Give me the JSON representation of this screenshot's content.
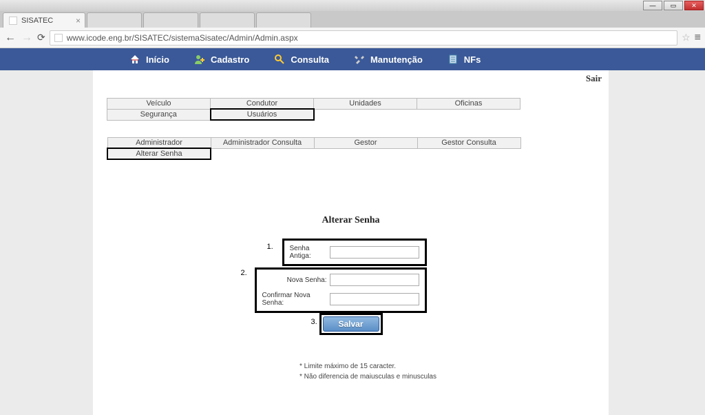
{
  "browser": {
    "active_tab_title": "SISATEC",
    "url": "www.icode.eng.br/SISATEC/sistemaSisatec/Admin/Admin.aspx"
  },
  "top_nav": {
    "items": [
      {
        "label": "Início",
        "icon": "home"
      },
      {
        "label": "Cadastro",
        "icon": "user-add"
      },
      {
        "label": "Consulta",
        "icon": "search"
      },
      {
        "label": "Manutenção",
        "icon": "tools"
      },
      {
        "label": "NFs",
        "icon": "document"
      }
    ]
  },
  "logout_label": "Sair",
  "tabs_row1": [
    {
      "label": "Veículo",
      "selected": false
    },
    {
      "label": "Condutor",
      "selected": false
    },
    {
      "label": "Unidades",
      "selected": false
    },
    {
      "label": "Oficinas",
      "selected": false
    }
  ],
  "tabs_row1b": [
    {
      "label": "Segurança",
      "selected": false
    },
    {
      "label": "Usuários",
      "selected": true
    }
  ],
  "tabs_row2": [
    {
      "label": "Administrador",
      "selected": false
    },
    {
      "label": "Administrador Consulta",
      "selected": false
    },
    {
      "label": "Gestor",
      "selected": false
    },
    {
      "label": "Gestor Consulta",
      "selected": false
    }
  ],
  "tabs_row2b": [
    {
      "label": "Alterar Senha",
      "selected": true
    }
  ],
  "form": {
    "title": "Alterar Senha",
    "old_password_label": "Senha Antiga:",
    "new_password_label": "Nova Senha:",
    "confirm_password_label": "Confirmar Nova Senha:",
    "save_label": "Salvar"
  },
  "annotations": {
    "n1": "1.",
    "n2": "2.",
    "n3": "3."
  },
  "footnotes": [
    "* Limite máximo de 15 caracter.",
    "* Não diferencia de maiusculas e minusculas"
  ]
}
